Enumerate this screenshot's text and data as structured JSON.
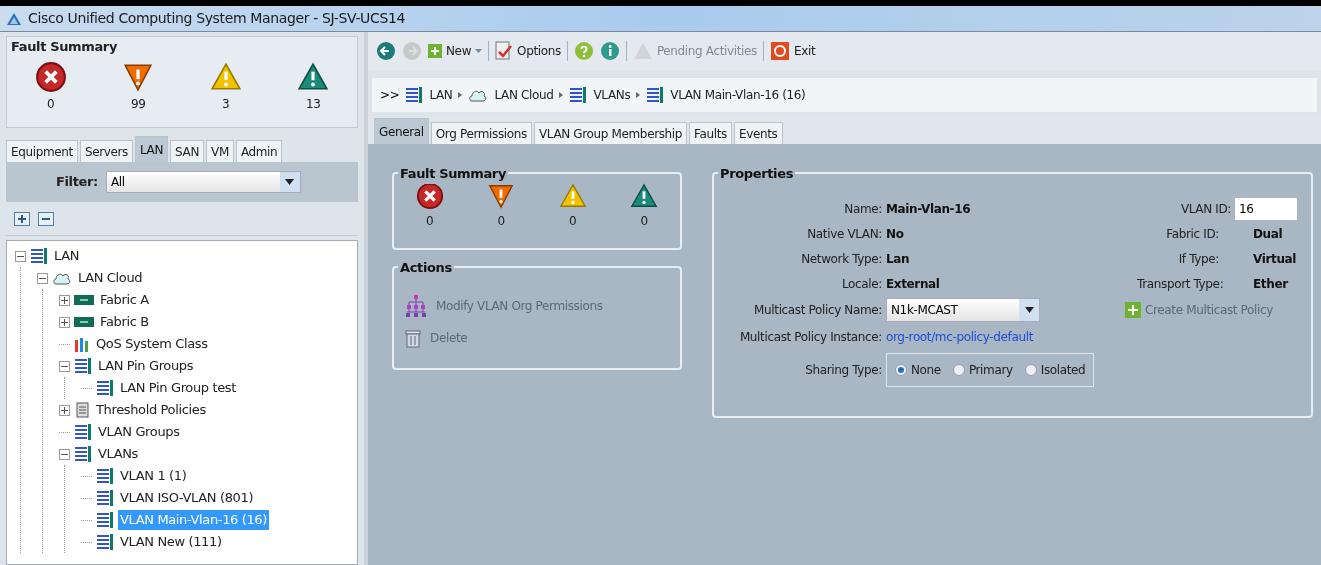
{
  "window": {
    "title": "Cisco Unified Computing System Manager - SJ-SV-UCS14"
  },
  "navigator": {
    "fault_summary": {
      "title": "Fault Summary",
      "counts": [
        {
          "kind": "critical",
          "count": "0"
        },
        {
          "kind": "major",
          "count": "99"
        },
        {
          "kind": "minor",
          "count": "3"
        },
        {
          "kind": "warning",
          "count": "13"
        }
      ]
    },
    "tabs": [
      {
        "label": "Equipment",
        "selected": false
      },
      {
        "label": "Servers",
        "selected": false
      },
      {
        "label": "LAN",
        "selected": true
      },
      {
        "label": "SAN",
        "selected": false
      },
      {
        "label": "VM",
        "selected": false
      },
      {
        "label": "Admin",
        "selected": false
      }
    ],
    "filter": {
      "label": "Filter:",
      "value": "All"
    },
    "tree": [
      {
        "label": "LAN",
        "kind": "list",
        "expanded": true,
        "selected": false,
        "children": [
          {
            "label": "LAN Cloud",
            "kind": "cloud",
            "expanded": true,
            "selected": false,
            "children": [
              {
                "label": "Fabric A",
                "kind": "fabric",
                "expanded": false,
                "selected": false
              },
              {
                "label": "Fabric B",
                "kind": "fabric",
                "expanded": false,
                "selected": false
              },
              {
                "label": "QoS System Class",
                "kind": "qos",
                "selected": false
              },
              {
                "label": "LAN Pin Groups",
                "kind": "list",
                "expanded": true,
                "selected": false,
                "children": [
                  {
                    "label": "LAN Pin Group test",
                    "kind": "list",
                    "selected": false
                  }
                ]
              },
              {
                "label": "Threshold Policies",
                "kind": "scroll",
                "expanded": false,
                "selected": false
              },
              {
                "label": "VLAN Groups",
                "kind": "list",
                "selected": false
              },
              {
                "label": "VLANs",
                "kind": "list",
                "expanded": true,
                "selected": false,
                "children": [
                  {
                    "label": "VLAN 1 (1)",
                    "kind": "list",
                    "selected": false
                  },
                  {
                    "label": "VLAN ISO-VLAN (801)",
                    "kind": "list",
                    "selected": false
                  },
                  {
                    "label": "VLAN Main-Vlan-16 (16)",
                    "kind": "list",
                    "selected": true
                  },
                  {
                    "label": "VLAN New (111)",
                    "kind": "list",
                    "selected": false
                  }
                ]
              }
            ]
          }
        ]
      }
    ]
  },
  "toolbar": [
    {
      "kind": "back",
      "disabled": false
    },
    {
      "kind": "forward",
      "disabled": true
    },
    {
      "kind": "new",
      "label": "New",
      "disabled": false
    },
    {
      "kind": "options",
      "label": "Options",
      "disabled": false
    },
    {
      "kind": "help",
      "disabled": false
    },
    {
      "kind": "info",
      "disabled": false
    },
    {
      "kind": "pending",
      "label": "Pending Activities",
      "disabled": true
    },
    {
      "kind": "exit",
      "label": "Exit",
      "disabled": false
    }
  ],
  "breadcrumb": {
    "prefix": ">>",
    "items": [
      {
        "label": "LAN",
        "kind": "list"
      },
      {
        "label": "LAN Cloud",
        "kind": "cloud"
      },
      {
        "label": "VLANs",
        "kind": "list"
      },
      {
        "label": "VLAN Main-Vlan-16 (16)",
        "kind": "list"
      }
    ]
  },
  "tabs": [
    {
      "label": "General",
      "selected": true
    },
    {
      "label": "Org Permissions",
      "selected": false
    },
    {
      "label": "VLAN Group Membership",
      "selected": false
    },
    {
      "label": "Faults",
      "selected": false
    },
    {
      "label": "Events",
      "selected": false
    }
  ],
  "fault_summary": {
    "title": "Fault Summary",
    "counts": [
      {
        "kind": "critical",
        "count": "0"
      },
      {
        "kind": "major",
        "count": "0"
      },
      {
        "kind": "minor",
        "count": "0"
      },
      {
        "kind": "warning",
        "count": "0"
      }
    ]
  },
  "actions": {
    "title": "Actions",
    "items": [
      {
        "kind": "org",
        "label": "Modify VLAN Org Permissions"
      },
      {
        "kind": "delete",
        "label": "Delete"
      }
    ]
  },
  "properties": {
    "title": "Properties",
    "left": [
      {
        "label": "Name:",
        "value": "Main-Vlan-16"
      },
      {
        "label": "Native VLAN:",
        "value": "No"
      },
      {
        "label": "Network Type:",
        "value": "Lan"
      },
      {
        "label": "Locale:",
        "value": "External"
      }
    ],
    "multicast_policy_name": {
      "label": "Multicast Policy Name:",
      "value": "N1k-MCAST"
    },
    "multicast_policy_instance": {
      "label": "Multicast Policy Instance:",
      "value": "org-root/mc-policy-default"
    },
    "sharing_type": {
      "label": "Sharing Type:",
      "options": [
        {
          "label": "None",
          "selected": true
        },
        {
          "label": "Primary",
          "selected": false
        },
        {
          "label": "Isolated",
          "selected": false
        }
      ]
    },
    "vlan_id": {
      "label": "VLAN ID:",
      "value": "16"
    },
    "right": [
      {
        "label": "Fabric ID:",
        "value": "Dual"
      },
      {
        "label": "If Type:",
        "value": "Virtual"
      },
      {
        "label": "Transport Type:",
        "value": "Ether"
      }
    ],
    "create_link": "Create Multicast Policy"
  }
}
